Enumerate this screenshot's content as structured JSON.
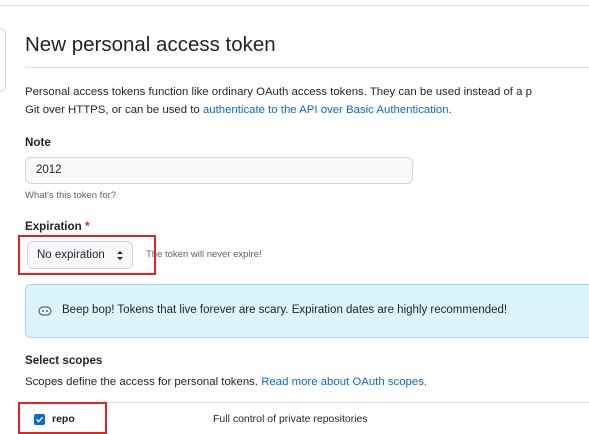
{
  "page": {
    "title": "New personal access token",
    "description_text": "Personal access tokens function like ordinary OAuth access tokens. They can be used instead of a p",
    "description_line2_text": "Git over HTTPS, or can be used to ",
    "description_link": "authenticate to the API over Basic Authentication",
    "description_end": "."
  },
  "note": {
    "label": "Note",
    "value": "2012",
    "hint": "What's this token for?"
  },
  "expiration": {
    "label": "Expiration",
    "required_mark": "*",
    "selected": "No expiration",
    "arrows": "↕",
    "note": "The token will never expire!"
  },
  "flash": {
    "icon": "copilot-icon",
    "message": "Beep bop! Tokens that live forever are scary. Expiration dates are highly recommended!"
  },
  "scopes": {
    "heading": "Select scopes",
    "description": "Scopes define the access for personal tokens. ",
    "link": "Read more about OAuth scopes.",
    "items": [
      {
        "name": "repo",
        "checked": true,
        "description": "Full control of private repositories"
      }
    ]
  },
  "colors": {
    "link": "#0969da",
    "highlight": "#e02424",
    "flash_bg": "#ddf4ff",
    "required": "#cf222e"
  }
}
